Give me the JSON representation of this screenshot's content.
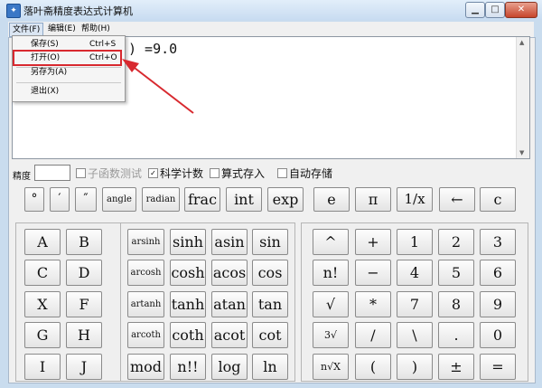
{
  "window": {
    "title": "落叶斋精度表达式计算机",
    "app_icon": "calculator-icon"
  },
  "menubar": {
    "file": "文件(F)",
    "edit": "编辑(E)",
    "help": "帮助(H)"
  },
  "file_menu": {
    "items": [
      {
        "label": "保存(S)",
        "shortcut": "Ctrl+S"
      },
      {
        "label": "打开(O)",
        "shortcut": "Ctrl+O"
      },
      {
        "label": "另存为(A)",
        "shortcut": ""
      },
      {
        "label": "退出(X)",
        "shortcut": ""
      }
    ]
  },
  "display": {
    "expression_visible": ") =9.0"
  },
  "options": {
    "precision_label": "精度",
    "precision_value": "",
    "subfunction_test": "子函数测试",
    "scientific_notation": "科学计数",
    "save_formula": "算式存入",
    "auto_save": "自动存储",
    "checked": {
      "subfunction_test": false,
      "scientific_notation": true,
      "save_formula": false,
      "auto_save": false
    }
  },
  "top_row": [
    "°",
    "′",
    "″",
    "angle",
    "radian",
    "frac",
    "int",
    "exp",
    "e",
    "π",
    "1/x",
    "←",
    "c"
  ],
  "grid": {
    "letters": [
      [
        "A",
        "B"
      ],
      [
        "C",
        "D"
      ],
      [
        "X",
        "F"
      ],
      [
        "G",
        "H"
      ],
      [
        "I",
        "J"
      ]
    ],
    "functions": [
      [
        "arsinh",
        "sinh",
        "asin",
        "sin"
      ],
      [
        "arcosh",
        "cosh",
        "acos",
        "cos"
      ],
      [
        "artanh",
        "tanh",
        "atan",
        "tan"
      ],
      [
        "arcoth",
        "coth",
        "acot",
        "cot"
      ],
      [
        "mod",
        "n!!",
        "log",
        "ln"
      ]
    ],
    "operators": [
      [
        "^",
        "+"
      ],
      [
        "n!",
        "−"
      ],
      [
        "√",
        "*"
      ],
      [
        "3√",
        "/"
      ],
      [
        "n√X",
        "("
      ]
    ],
    "digits": [
      [
        "1",
        "2",
        "3"
      ],
      [
        "4",
        "5",
        "6"
      ],
      [
        "7",
        "8",
        "9"
      ],
      [
        "\\",
        ".",
        "0"
      ],
      [
        ")",
        "±",
        "="
      ]
    ]
  },
  "colors": {
    "annotation_red": "#d8292f"
  }
}
